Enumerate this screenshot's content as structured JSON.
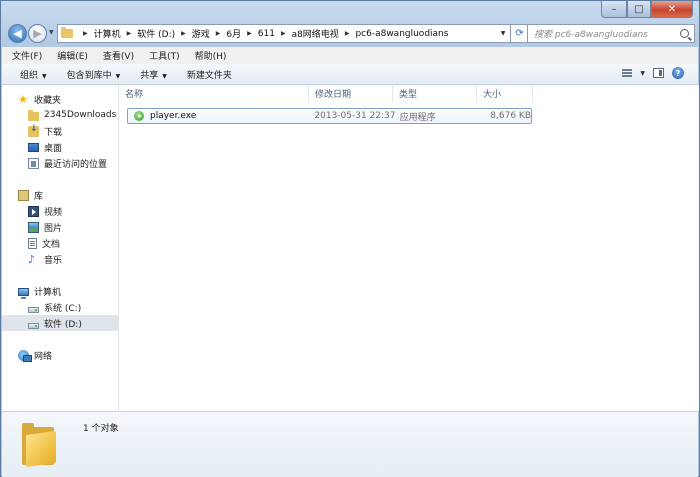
{
  "window": {
    "controls": {
      "minimize": "–",
      "maximize": "□",
      "close": "✕"
    }
  },
  "navigation": {
    "back_icon": "back-arrow-icon",
    "forward_icon": "forward-arrow-icon",
    "breadcrumbs": [
      "计算机",
      "软件 (D:)",
      "游戏",
      "6月",
      "611",
      "a8网络电视",
      "pc6-a8wangluodians"
    ],
    "search_placeholder": "搜索 pc6-a8wangluodians",
    "refresh_icon": "⟳"
  },
  "menu": [
    "文件(F)",
    "编辑(E)",
    "查看(V)",
    "工具(T)",
    "帮助(H)"
  ],
  "commands": {
    "organize": "组织",
    "include_in_library": "包含到库中",
    "share": "共享",
    "new_folder": "新建文件夹"
  },
  "nav_pane": {
    "favorites": {
      "label": "收藏夹",
      "items": [
        "2345Downloads",
        "下载",
        "桌面",
        "最近访问的位置"
      ]
    },
    "libraries": {
      "label": "库",
      "items": [
        "视频",
        "图片",
        "文档",
        "音乐"
      ]
    },
    "computer": {
      "label": "计算机",
      "items": [
        "系统 (C:)",
        "软件 (D:)"
      ],
      "selected": "软件 (D:)"
    },
    "network": {
      "label": "网络"
    }
  },
  "columns": [
    "名称",
    "修改日期",
    "类型",
    "大小"
  ],
  "files": [
    {
      "name": "player.exe",
      "modified": "2013-05-31 22:37",
      "type": "应用程序",
      "size": "8,676 KB"
    }
  ],
  "details": {
    "count": "1 个对象"
  },
  "colors": {
    "accent": "#2d6fb7",
    "selection": "#dfe4ea",
    "exe_green": "#2d9a2d"
  }
}
